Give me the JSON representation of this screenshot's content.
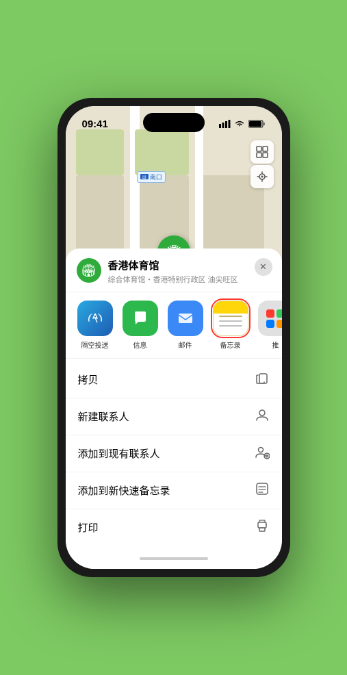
{
  "statusBar": {
    "time": "09:41",
    "hasLocation": true
  },
  "mapLabels": {
    "entrance": "南口"
  },
  "mapControls": {
    "mapViewIcon": "🗺",
    "locationIcon": "↗"
  },
  "locationPin": {
    "label": "香港体育馆"
  },
  "locationCard": {
    "name": "香港体育馆",
    "description": "综合体育馆・香港特别行政区 油尖旺区",
    "closeLabel": "✕"
  },
  "shareItems": [
    {
      "id": "airdrop",
      "label": "隔空投送",
      "type": "airdrop"
    },
    {
      "id": "messages",
      "label": "信息",
      "type": "messages"
    },
    {
      "id": "mail",
      "label": "邮件",
      "type": "mail"
    },
    {
      "id": "notes",
      "label": "备忘录",
      "type": "notes",
      "selected": true
    },
    {
      "id": "more",
      "label": "推",
      "type": "more"
    }
  ],
  "actionItems": [
    {
      "id": "copy",
      "label": "拷贝",
      "icon": "copy"
    },
    {
      "id": "new-contact",
      "label": "新建联系人",
      "icon": "person"
    },
    {
      "id": "add-contact",
      "label": "添加到现有联系人",
      "icon": "person-add"
    },
    {
      "id": "quick-note",
      "label": "添加到新快速备忘录",
      "icon": "note"
    },
    {
      "id": "print",
      "label": "打印",
      "icon": "print"
    }
  ]
}
